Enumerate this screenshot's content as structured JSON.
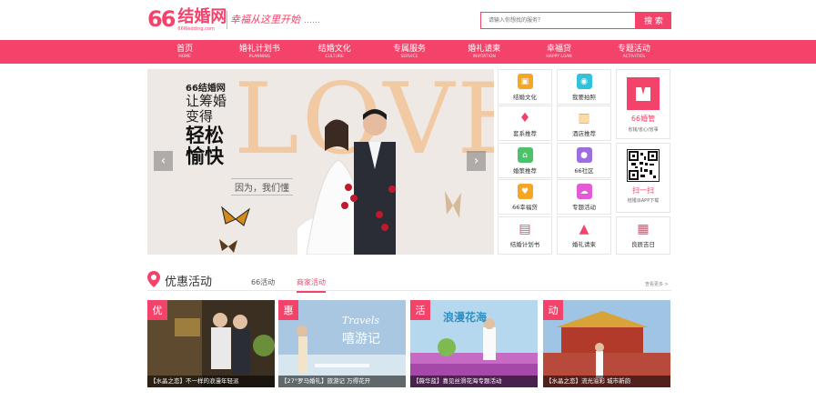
{
  "header": {
    "logo_num": "66",
    "logo_name": "结婚网",
    "logo_en": "66Wedding.com",
    "slogan": "幸福从这里开始",
    "slogan_dots": "……",
    "search_placeholder": "请输入你想找的服务？",
    "search_button": "搜 索"
  },
  "nav": [
    {
      "cn": "首页",
      "en": "HOME"
    },
    {
      "cn": "婚礼计划书",
      "en": "PLANNING"
    },
    {
      "cn": "结婚文化",
      "en": "CULTURE"
    },
    {
      "cn": "专属服务",
      "en": "SERVICE"
    },
    {
      "cn": "婚礼请柬",
      "en": "INVITATION"
    },
    {
      "cn": "幸福贷",
      "en": "HAPPY LOAN"
    },
    {
      "cn": "专题活动",
      "en": "ACTIVITIES"
    }
  ],
  "banner": {
    "brand": "66结婚网",
    "line1": "让筹婚",
    "line2": "变得",
    "line3": "轻松",
    "line4": "愉快",
    "love": "LOVE",
    "sub": "因为，我们懂",
    "prev": "‹",
    "next": "›"
  },
  "services": [
    {
      "label": "结婚文化",
      "icon": "bag-icon",
      "color": "#f5a623",
      "glyph": "▣"
    },
    {
      "label": "我要拍照",
      "icon": "camera-icon",
      "color": "#32c3dc",
      "glyph": "◉"
    },
    {
      "label": "套系推荐",
      "icon": "flame-icon",
      "color": "#f4436b",
      "glyph": "♦"
    },
    {
      "label": "酒店推荐",
      "icon": "building-icon",
      "color": "#f5a623",
      "glyph": "▥"
    },
    {
      "label": "婚策推荐",
      "icon": "house-icon",
      "color": "#4cc36b",
      "glyph": "⌂"
    },
    {
      "label": "66社区",
      "icon": "people-icon",
      "color": "#9b6fe0",
      "glyph": "●"
    },
    {
      "label": "66幸福贷",
      "icon": "heart-icon",
      "color": "#f5a623",
      "glyph": "♥"
    },
    {
      "label": "专题活动",
      "icon": "cloud-icon",
      "color": "#e35ad6",
      "glyph": "☁"
    },
    {
      "label": "结婚计划书",
      "icon": "notebook-icon",
      "color": "#f4436b",
      "glyph": "▤"
    },
    {
      "label": "婚礼请柬",
      "icon": "picture-icon",
      "color": "#f4436b",
      "glyph": "▲"
    },
    {
      "label": "良辰吉日",
      "icon": "calendar-icon",
      "color": "#f4436b",
      "glyph": "▦"
    }
  ],
  "butler": {
    "label": "66婚管",
    "sub": "省钱/省心/省事"
  },
  "app": {
    "label": "扫一扫",
    "sub": "结婚派APP下载"
  },
  "promo": {
    "title": "优惠活动",
    "tab1": "66活动",
    "tab2": "商家活动",
    "more": "查看更多 >",
    "cards": [
      {
        "tag": "优",
        "caption": "【水晶之恋】不一样的浪漫年轻派"
      },
      {
        "tag": "惠",
        "caption": "【27°罗马婚礼】旅游记 万得花开"
      },
      {
        "tag": "活",
        "caption": "【薇华蓝】喜见丝滑花海专题活动"
      },
      {
        "tag": "动",
        "caption": "【水晶之恋】流光溢彩 城市新韵"
      }
    ],
    "card2_script": "Travels",
    "card2_title": "嘻游记",
    "card3_title": "浪漫花海"
  }
}
